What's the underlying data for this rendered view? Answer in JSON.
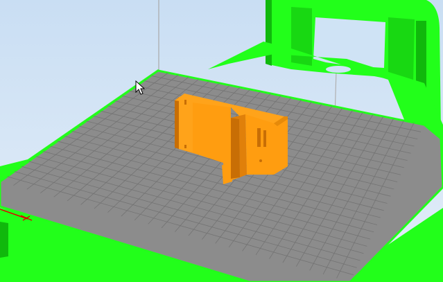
{
  "viewport": {
    "kind": "3d-printer-slicer-view",
    "colors": {
      "background": "#d4e6f6",
      "printer_frame": "#22ff1a",
      "printer_frame_dark": "#10b80c",
      "build_plate": "#8c8c8c",
      "grid_line": "#737373",
      "model": "#ff9d10",
      "model_side": "#e0800a",
      "model_shadow": "#c86e05",
      "axis_x": "#e00000"
    }
  },
  "build_plate": {
    "icon": "grid-icon"
  },
  "model": {
    "name": "orange-part",
    "selected": false
  },
  "axes": {
    "icon": "axis-origin-icon"
  },
  "cursor": {
    "icon": "arrow-pointer-icon"
  }
}
